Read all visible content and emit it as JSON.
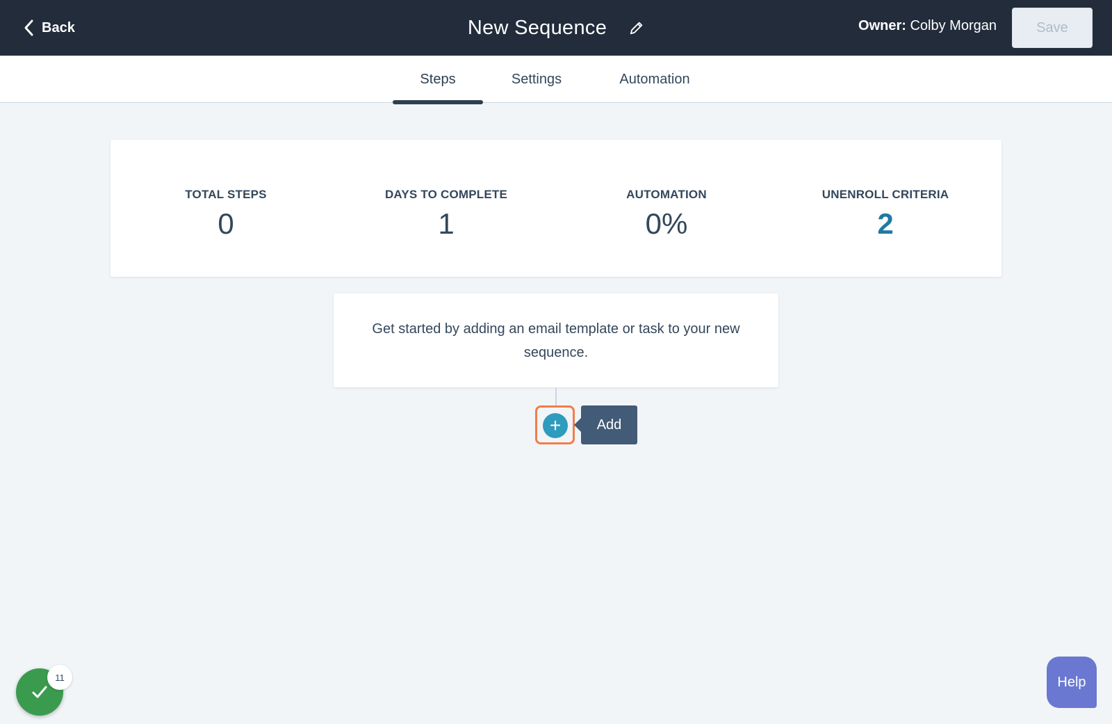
{
  "header": {
    "back_label": "Back",
    "title": "New Sequence",
    "owner_label": "Owner:",
    "owner_name": "Colby Morgan",
    "save_label": "Save"
  },
  "tabs": [
    {
      "label": "Steps",
      "active": true
    },
    {
      "label": "Settings",
      "active": false
    },
    {
      "label": "Automation",
      "active": false
    }
  ],
  "stats": [
    {
      "label": "TOTAL STEPS",
      "value": "0"
    },
    {
      "label": "DAYS TO COMPLETE",
      "value": "1"
    },
    {
      "label": "AUTOMATION",
      "value": "0%"
    },
    {
      "label": "UNENROLL CRITERIA",
      "value": "2"
    }
  ],
  "empty_state": {
    "message": "Get started by adding an email template or task to your new sequence."
  },
  "add": {
    "tooltip": "Add",
    "button_symbol": "+"
  },
  "checklist": {
    "badge_count": "11"
  },
  "help_label": "Help",
  "colors": {
    "header_bg": "#222c3b",
    "accent": "#2f9bbd",
    "highlight": "#f07d4a",
    "help_bg": "#6a78d1",
    "checklist_bg": "#3a9b4f"
  }
}
